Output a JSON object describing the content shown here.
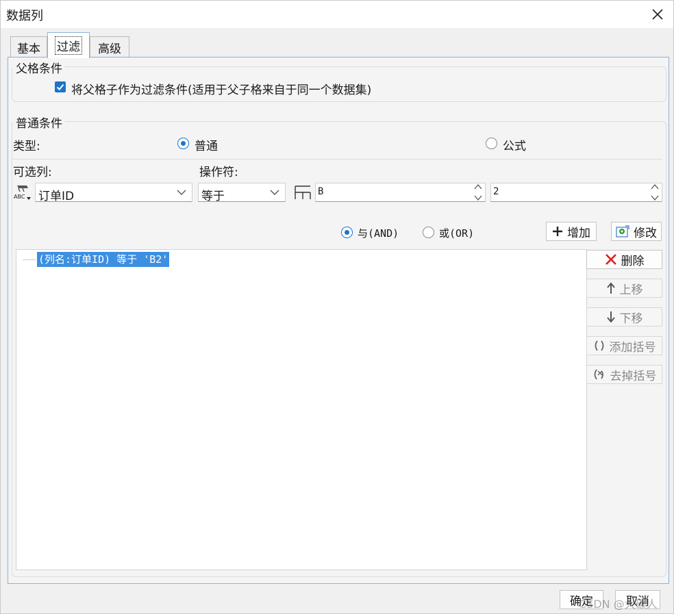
{
  "dialog": {
    "title": "数据列"
  },
  "tabs": [
    {
      "label": "基本"
    },
    {
      "label": "过滤"
    },
    {
      "label": "高级"
    }
  ],
  "parent_section": {
    "title": "父格条件",
    "checkbox_label": "将父格子作为过滤条件(适用于父子格来自于同一个数据集)",
    "checked": true
  },
  "normal_section": {
    "title": "普通条件",
    "type_label": "类型:",
    "type_options": [
      "普通",
      "公式"
    ],
    "type_selected": "普通",
    "column_label": "可选列:",
    "operator_label": "操作符:",
    "column_value": "订单ID",
    "operator_value": "等于",
    "cell_col_value": "B",
    "cell_row_value": "2"
  },
  "logic": {
    "and_label": "与(AND)",
    "or_label": "或(OR)",
    "selected": "and"
  },
  "buttons": {
    "add": "增加",
    "modify": "修改",
    "delete": "删除",
    "move_up": "上移",
    "move_down": "下移",
    "add_bracket": "添加括号",
    "remove_bracket": "去掉括号",
    "ok": "确定",
    "cancel": "取消"
  },
  "conditions": [
    {
      "text": "(列名:订单ID) 等于 'B2'"
    }
  ],
  "watermark": "CSDN @大碳人",
  "colors": {
    "accent": "#1a75c9",
    "selection": "#3d8fe0",
    "add_icon": "#222222",
    "delete_icon": "#e02020",
    "modify_icon": "#2a9d3a"
  }
}
